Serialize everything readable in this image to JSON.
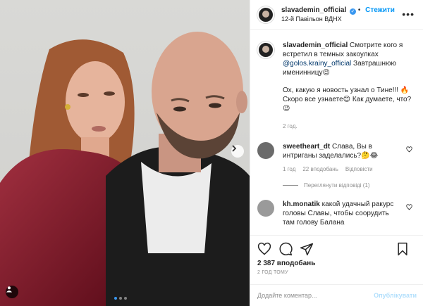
{
  "post": {
    "username": "slavademin_official",
    "follow_label": "Стежити",
    "location": "12-й Павільон ВДНХ",
    "verified_mark": "✓",
    "more_icon": "more-options-icon"
  },
  "caption": {
    "username": "slavademin_official",
    "text_1": " Смотрите кого я встретил в темных закоулках ",
    "mention": "@golos.krainy_official",
    "text_2": " Завтрашнюю именинницу😉",
    "text_3": "Ох, какую я новость узнал о Тине!!! 🔥 Скоро все узнаете😊 Как думаете, что?😉",
    "timestamp": "2 год."
  },
  "comments": [
    {
      "username": "sweetheart_dt",
      "text": " Слава, Вы в интриганы заделались?🤔😂",
      "time": "1 год",
      "likes": "22 вподобань",
      "reply": "Відповісти",
      "avatar_color": "#6b6b6b"
    },
    {
      "username": "kh.monatik",
      "text": " какой удачный ракурс головы Славы, чтобы соорудить там голову Балана",
      "avatar_color": "#9a9a9a"
    }
  ],
  "view_replies": "Переглянути відповіді (1)",
  "actions": {
    "likes": "2 387 вподобань",
    "time_ago": "2 ГОД ТОМУ"
  },
  "add_comment": {
    "placeholder": "Додайте коментар...",
    "publish": "Опублікувати"
  },
  "carousel": {
    "slides": 3,
    "active_slide": 1
  },
  "colors": {
    "accent": "#0095f6",
    "dress": "#6e1020",
    "jacket": "#1c1c1c"
  }
}
